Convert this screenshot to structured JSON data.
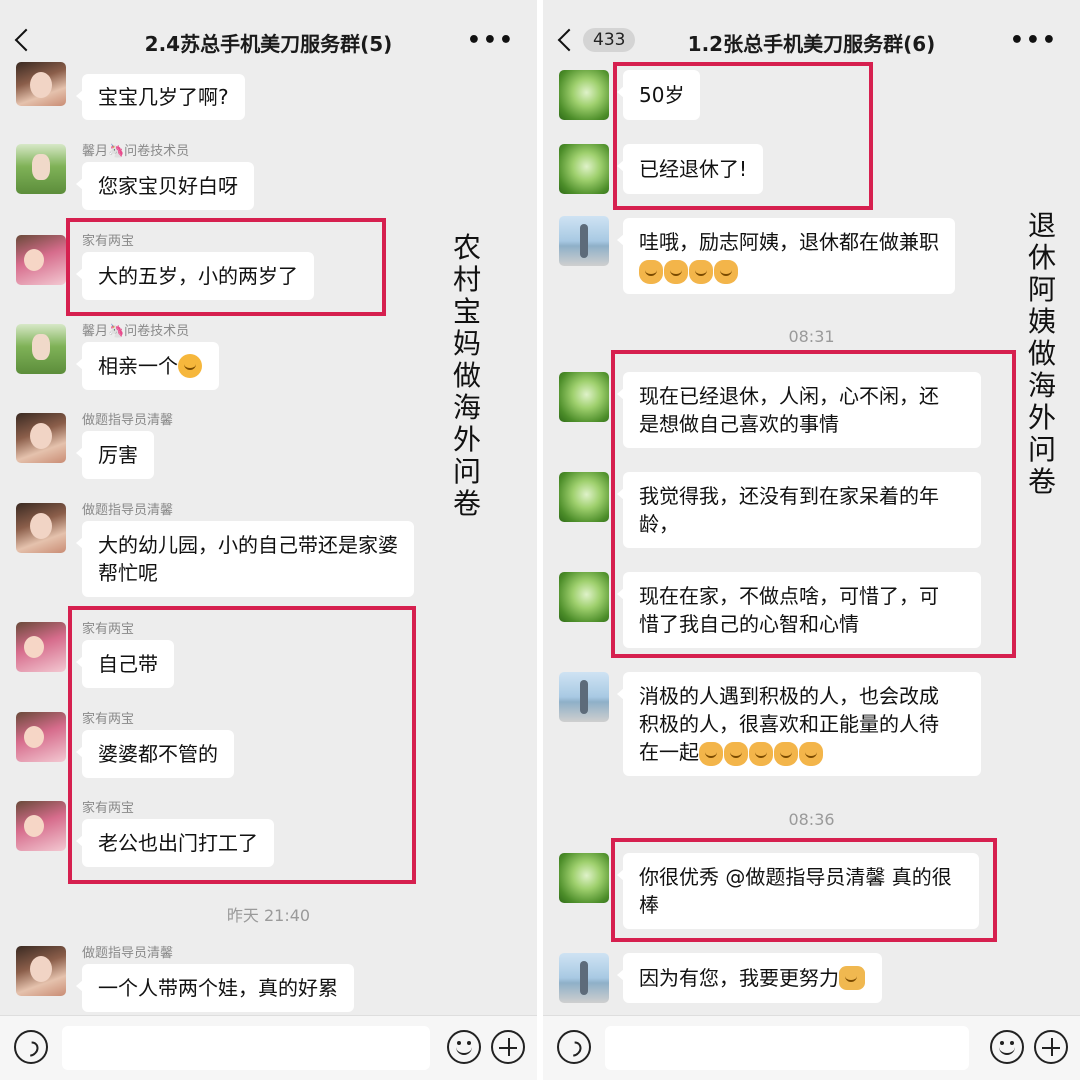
{
  "left_chat": {
    "title": "2.4苏总手机美刀服务群(5)",
    "messages": [
      {
        "sender": "",
        "text": "宝宝几岁了啊?"
      },
      {
        "sender": "馨月🦄问卷技术员",
        "text": "您家宝贝好白呀"
      },
      {
        "sender": "家有两宝",
        "text": "大的五岁，小的两岁了"
      },
      {
        "sender": "馨月🦄问卷技术员",
        "text": "相亲一个"
      },
      {
        "sender": "做题指导员清馨",
        "text": "厉害"
      },
      {
        "sender": "做题指导员清馨",
        "text_line1": "大的幼儿园，小的自己带还是家婆",
        "text_line2": "帮忙呢"
      },
      {
        "sender": "家有两宝",
        "text": "自己带"
      },
      {
        "sender": "家有两宝",
        "text": "婆婆都不管的"
      },
      {
        "sender": "家有两宝",
        "text": "老公也出门打工了"
      },
      {
        "sender": "做题指导员清馨",
        "text": "一个人带两个娃，真的好累"
      }
    ],
    "timestamp": "昨天 21:40",
    "annotation": "农村宝妈做海外问卷"
  },
  "right_chat": {
    "title": "1.2张总手机美刀服务群(6)",
    "unread_badge": "433",
    "messages": [
      {
        "text": "50岁"
      },
      {
        "text": "已经退休了!"
      },
      {
        "text": "哇哦，励志阿姨，退休都在做兼职"
      },
      {
        "text_line1": "现在已经退休，人闲，心不闲，还",
        "text_line2": "是想做自己喜欢的事情"
      },
      {
        "text_line1": "我觉得我，还没有到在家呆着的年",
        "text_line2": "龄，"
      },
      {
        "text_line1": "现在在家，不做点啥，可惜了，可",
        "text_line2": "惜了我自己的心智和心情"
      },
      {
        "text_line1": "消极的人遇到积极的人，也会改成",
        "text_line2": "积极的人，很喜欢和正能量的人待",
        "text_line3": "在一起"
      },
      {
        "text_line1": "你很优秀 @做题指导员清馨 真的很",
        "text_line2": "棒"
      },
      {
        "text": "因为有您，我要更努力"
      }
    ],
    "timestamps": [
      "08:31",
      "08:36"
    ],
    "annotation": "退休阿姨做海外问卷"
  },
  "colors": {
    "highlight": "#d6204f",
    "chat_bg": "#ededed",
    "bubble_bg": "#ffffff"
  }
}
